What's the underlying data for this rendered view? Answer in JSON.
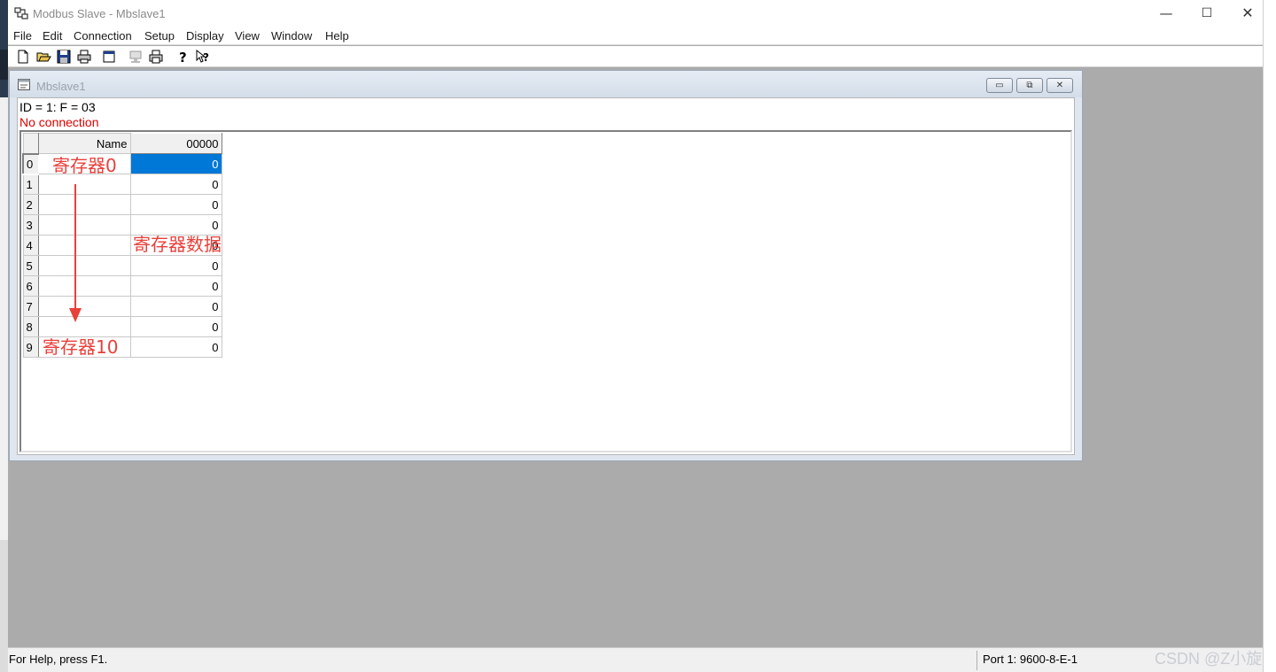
{
  "app": {
    "title": "Modbus Slave - Mbslave1",
    "window_controls": {
      "minimize": "—",
      "maximize": "☐",
      "close": "✕"
    }
  },
  "menu": {
    "items": [
      "File",
      "Edit",
      "Connection",
      "Setup",
      "Display",
      "View",
      "Window",
      "Help"
    ]
  },
  "toolbar": {
    "icons": [
      "new-icon",
      "open-icon",
      "save-icon",
      "print-icon",
      "window-icon",
      "monitor-icon",
      "printer-icon",
      "help-icon",
      "context-help-icon"
    ]
  },
  "child": {
    "title": "Mbslave1",
    "controls": {
      "minimize": "▭",
      "maximize": "⧉",
      "close": "✕"
    },
    "id_line": "ID = 1: F = 03",
    "status": "No connection",
    "status_color": "#e00000",
    "table": {
      "header_name": "Name",
      "header_address": "00000",
      "rows": [
        {
          "index": "0",
          "name": "",
          "value": "0"
        },
        {
          "index": "1",
          "name": "",
          "value": "0"
        },
        {
          "index": "2",
          "name": "",
          "value": "0"
        },
        {
          "index": "3",
          "name": "",
          "value": "0"
        },
        {
          "index": "4",
          "name": "",
          "value": "0"
        },
        {
          "index": "5",
          "name": "",
          "value": "0"
        },
        {
          "index": "6",
          "name": "",
          "value": "0"
        },
        {
          "index": "7",
          "name": "",
          "value": "0"
        },
        {
          "index": "8",
          "name": "",
          "value": "0"
        },
        {
          "index": "9",
          "name": "",
          "value": "0"
        }
      ],
      "selected_color": "#0078d7"
    }
  },
  "annotations": {
    "register_first": "寄存器0",
    "register_data": "寄存器数据",
    "register_last": "寄存器10",
    "color": "#e8403a"
  },
  "statusbar": {
    "help": "For Help, press F1.",
    "port": "Port 1: 9600-8-E-1"
  },
  "watermark": "CSDN @Z小旋"
}
